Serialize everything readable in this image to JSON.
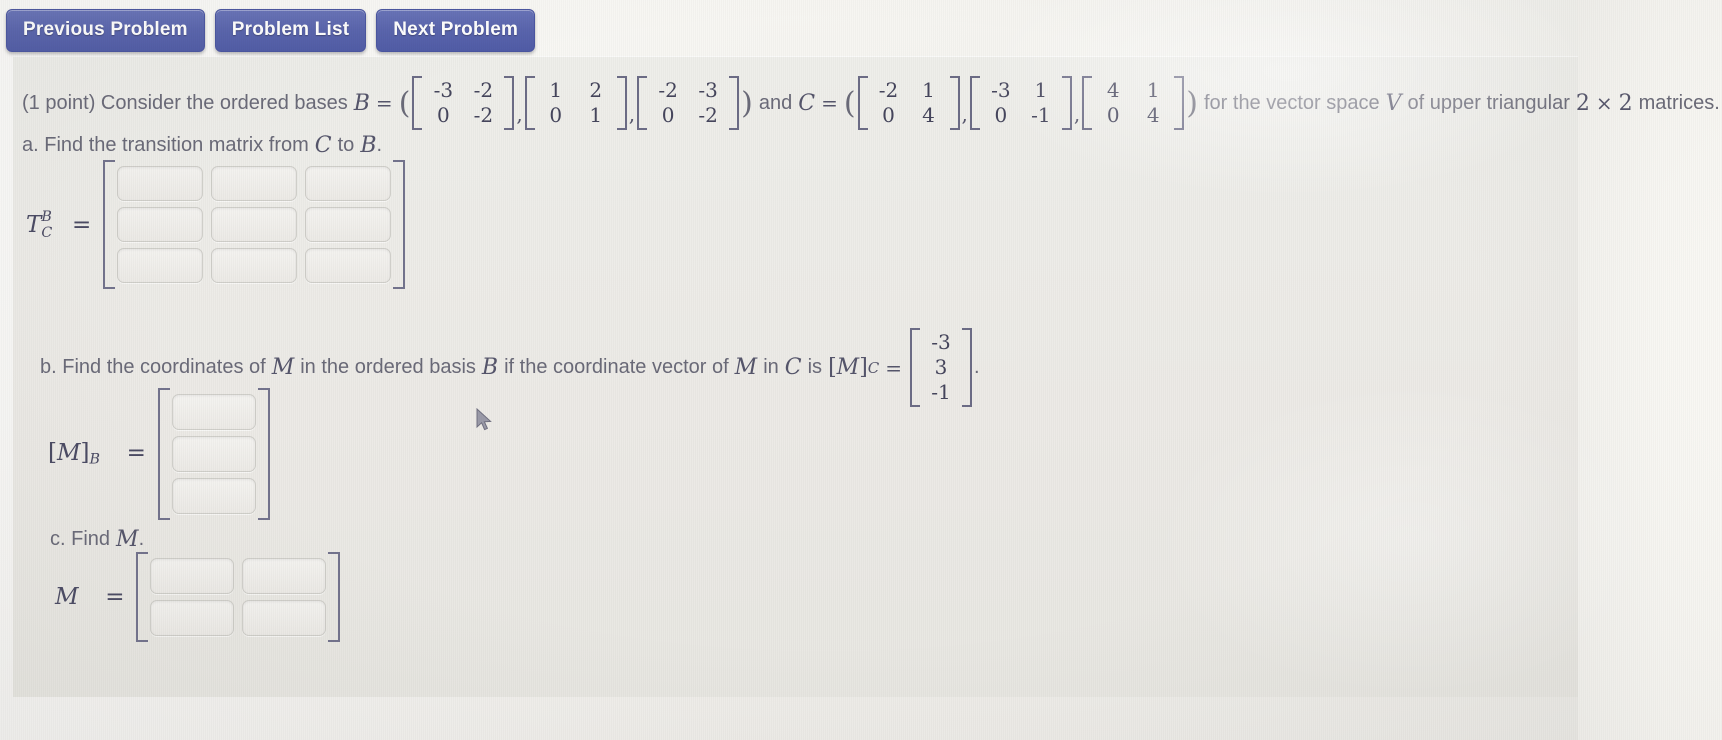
{
  "nav": {
    "previous_label": "Previous Problem",
    "list_label": "Problem List",
    "next_label": "Next Problem",
    "button_color": "#5964ad"
  },
  "problem": {
    "points_prefix": "(1 point) Consider the ordered bases",
    "var_B": "B",
    "equals": "=",
    "and_text": "and",
    "var_C": "C",
    "tail_text_1": "for the vector space",
    "var_V": "V",
    "tail_text_2": "of upper triangular",
    "dim_left": "2",
    "times": "×",
    "dim_right": "2",
    "tail_text_3": "matrices.",
    "basis_B": [
      {
        "rows": [
          [
            "-3",
            "-2"
          ],
          [
            "0",
            "-2"
          ]
        ]
      },
      {
        "rows": [
          [
            "1",
            "2"
          ],
          [
            "0",
            "1"
          ]
        ]
      },
      {
        "rows": [
          [
            "-2",
            "-3"
          ],
          [
            "0",
            "-2"
          ]
        ]
      }
    ],
    "basis_C": [
      {
        "rows": [
          [
            "-2",
            "1"
          ],
          [
            "0",
            "4"
          ]
        ]
      },
      {
        "rows": [
          [
            "-3",
            "1"
          ],
          [
            "0",
            "-1"
          ]
        ]
      },
      {
        "rows": [
          [
            "4",
            "1"
          ],
          [
            "0",
            "4"
          ]
        ]
      }
    ]
  },
  "part_a": {
    "prompt_prefix": "a. Find the transition matrix from",
    "from_basis": "C",
    "to_word": "to",
    "to_basis": "B",
    "period": ".",
    "label_base": "T",
    "label_sup": "B",
    "label_sub": "C",
    "label_equals": "=",
    "inputs": [
      [
        "",
        "",
        ""
      ],
      [
        "",
        "",
        ""
      ],
      [
        "",
        "",
        ""
      ]
    ],
    "placeholder": ""
  },
  "part_b": {
    "prompt_prefix": "b. Find the coordinates of",
    "var_M": "M",
    "mid_text": "in the ordered basis",
    "basis_B": "B",
    "cond_text": "if the coordinate vector of",
    "var_M2": "M",
    "in_word": "in",
    "basis_C": "C",
    "is_word": "is",
    "coord_label_open": "[",
    "coord_label_var": "M",
    "coord_label_close": "]",
    "coord_label_sub": "C",
    "coord_equals": "=",
    "coord_vector": [
      "-3",
      "3",
      "-1"
    ],
    "trailing_period": ".",
    "answer_label_open": "[",
    "answer_label_var": "M",
    "answer_label_close": "]",
    "answer_label_sub": "B",
    "answer_equals": "=",
    "inputs": [
      "",
      "",
      ""
    ]
  },
  "part_c": {
    "prompt_prefix": "c. Find",
    "var_M": "M",
    "period": ".",
    "label_var": "M",
    "label_equals": "=",
    "inputs": [
      [
        "",
        ""
      ],
      [
        "",
        ""
      ]
    ]
  },
  "cursor": {
    "icon": "mouse-pointer-icon"
  }
}
